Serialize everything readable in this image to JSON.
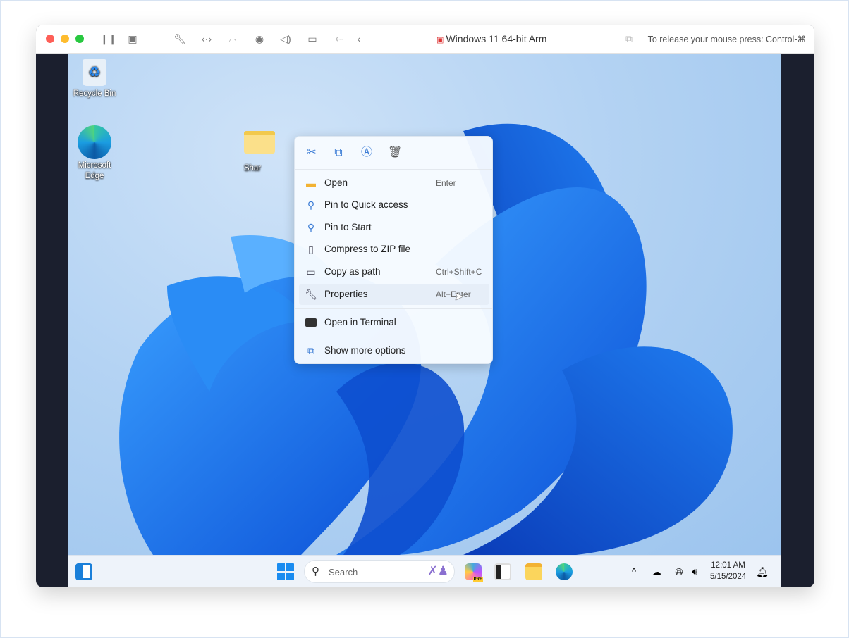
{
  "titlebar": {
    "title": "Windows 11 64-bit Arm",
    "release_hint": "To release your mouse press: Control-⌘",
    "icons": [
      "pause-icon",
      "snapshot-icon",
      "settings-wrench-icon",
      "network-icon",
      "disk-icon",
      "camera-icon",
      "sound-icon",
      "video-icon",
      "usb-icon",
      "chevron-left-icon"
    ]
  },
  "desktop": {
    "icons": [
      {
        "label": "Recycle Bin"
      },
      {
        "label": "Microsoft Edge"
      },
      {
        "label": "Shar"
      }
    ]
  },
  "context_menu": {
    "quick_actions": [
      "cut-icon",
      "copy-icon",
      "rename-icon",
      "delete-icon"
    ],
    "items": [
      {
        "label": "Open",
        "shortcut": "Enter",
        "icon": "folder-icon"
      },
      {
        "label": "Pin to Quick access",
        "shortcut": "",
        "icon": "pin-icon"
      },
      {
        "label": "Pin to Start",
        "shortcut": "",
        "icon": "pin-icon"
      },
      {
        "label": "Compress to ZIP file",
        "shortcut": "",
        "icon": "zip-icon"
      },
      {
        "label": "Copy as path",
        "shortcut": "Ctrl+Shift+C",
        "icon": "path-icon"
      },
      {
        "label": "Properties",
        "shortcut": "Alt+Enter",
        "icon": "wrench-icon",
        "highlighted": true
      },
      {
        "label": "Open in Terminal",
        "shortcut": "",
        "icon": "terminal-icon"
      },
      {
        "label": "Show more options",
        "shortcut": "",
        "icon": "expand-icon"
      }
    ]
  },
  "taskbar": {
    "search_placeholder": "Search",
    "time": "12:01 AM",
    "date": "5/15/2024",
    "copilot_badge": "PRE"
  },
  "colors": {
    "accent": "#0078d4",
    "sidebar": "#1b1f2e"
  }
}
